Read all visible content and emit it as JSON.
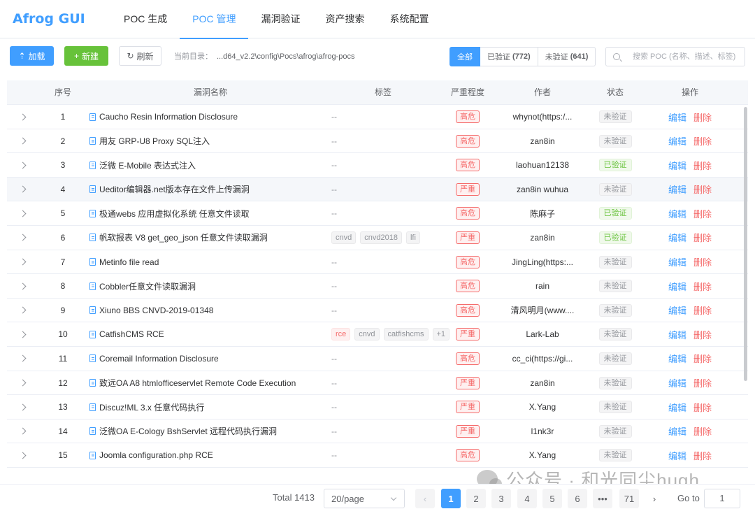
{
  "brand": "Afrog GUI",
  "nav": [
    {
      "label": "POC 生成",
      "active": false
    },
    {
      "label": "POC 管理",
      "active": true
    },
    {
      "label": "漏洞验证",
      "active": false
    },
    {
      "label": "资产搜索",
      "active": false
    },
    {
      "label": "系统配置",
      "active": false
    }
  ],
  "toolbar": {
    "load_label": "加载",
    "new_label": "新建",
    "refresh_label": "刷新",
    "dir_label": "当前目录：",
    "dir_value": "...d64_v2.2\\config\\Pocs\\afrog\\afrog-pocs"
  },
  "filters": {
    "all": "全部",
    "verified": "已验证",
    "verified_count": "(772)",
    "unverified": "未验证",
    "unverified_count": "(641)"
  },
  "search": {
    "placeholder": "搜索 POC (名称、描述、标签)"
  },
  "table": {
    "headers": {
      "no": "序号",
      "name": "漏洞名称",
      "tags": "标签",
      "severity": "严重程度",
      "author": "作者",
      "status": "状态",
      "ops": "操作"
    },
    "empty_tag": "--",
    "edit_label": "编辑",
    "delete_label": "删除",
    "rows": [
      {
        "no": "1",
        "name": "Caucho Resin Information Disclosure",
        "tags": [],
        "severity": "高危",
        "author": "whynot(https:/...",
        "status": "未验证",
        "verified": false
      },
      {
        "no": "2",
        "name": "用友 GRP-U8 Proxy SQL注入",
        "tags": [],
        "severity": "高危",
        "author": "zan8in",
        "status": "未验证",
        "verified": false
      },
      {
        "no": "3",
        "name": "泛微 E-Mobile 表达式注入",
        "tags": [],
        "severity": "高危",
        "author": "laohuan12138",
        "status": "已验证",
        "verified": true
      },
      {
        "no": "4",
        "name": "Ueditor编辑器.net版本存在文件上传漏洞",
        "tags": [],
        "severity": "严重",
        "author": "zan8in wuhua",
        "status": "未验证",
        "verified": false,
        "hover": true
      },
      {
        "no": "5",
        "name": "极通webs 应用虚拟化系统 任意文件读取",
        "tags": [],
        "severity": "高危",
        "author": "陈麻子",
        "status": "已验证",
        "verified": true
      },
      {
        "no": "6",
        "name": "帆软报表 V8 get_geo_json 任意文件读取漏洞",
        "tags": [
          {
            "t": "cnvd",
            "red": false
          },
          {
            "t": "cnvd2018",
            "red": false
          },
          {
            "t": "lfi",
            "red": false
          }
        ],
        "severity": "严重",
        "author": "zan8in",
        "status": "已验证",
        "verified": true
      },
      {
        "no": "7",
        "name": "Metinfo file read",
        "tags": [],
        "severity": "高危",
        "author": "JingLing(https:...",
        "status": "未验证",
        "verified": false
      },
      {
        "no": "8",
        "name": "Cobbler任意文件读取漏洞",
        "tags": [],
        "severity": "高危",
        "author": "rain",
        "status": "未验证",
        "verified": false
      },
      {
        "no": "9",
        "name": "Xiuno BBS CNVD-2019-01348",
        "tags": [],
        "severity": "高危",
        "author": "清风明月(www....",
        "status": "未验证",
        "verified": false
      },
      {
        "no": "10",
        "name": "CatfishCMS RCE",
        "tags": [
          {
            "t": "rce",
            "red": true
          },
          {
            "t": "cnvd",
            "red": false
          },
          {
            "t": "catfishcms",
            "red": false
          },
          {
            "t": "+1",
            "red": false
          }
        ],
        "severity": "严重",
        "author": "Lark-Lab",
        "status": "未验证",
        "verified": false
      },
      {
        "no": "11",
        "name": "Coremail Information Disclosure",
        "tags": [],
        "severity": "高危",
        "author": "cc_ci(https://gi...",
        "status": "未验证",
        "verified": false
      },
      {
        "no": "12",
        "name": "致远OA A8 htmlofficeservlet Remote Code Execution",
        "tags": [],
        "severity": "严重",
        "author": "zan8in",
        "status": "未验证",
        "verified": false
      },
      {
        "no": "13",
        "name": "Discuz!ML 3.x 任意代码执行",
        "tags": [],
        "severity": "严重",
        "author": "X.Yang",
        "status": "未验证",
        "verified": false
      },
      {
        "no": "14",
        "name": "泛微OA E-Cology BshServlet 远程代码执行漏洞",
        "tags": [],
        "severity": "严重",
        "author": "l1nk3r",
        "status": "未验证",
        "verified": false
      },
      {
        "no": "15",
        "name": "Joomla configuration.php RCE",
        "tags": [],
        "severity": "高危",
        "author": "X.Yang",
        "status": "未验证",
        "verified": false
      }
    ]
  },
  "pagination": {
    "total": "Total 1413",
    "page_size": "20/page",
    "pages": [
      "1",
      "2",
      "3",
      "4",
      "5",
      "6",
      "•••",
      "71"
    ],
    "current": "1",
    "goto_label": "Go to",
    "goto_value": "1"
  },
  "watermark": "公众号 · 和光同尘hugh",
  "colors": {
    "primary": "#409eff",
    "success": "#67c23a",
    "danger": "#f56c6c"
  }
}
